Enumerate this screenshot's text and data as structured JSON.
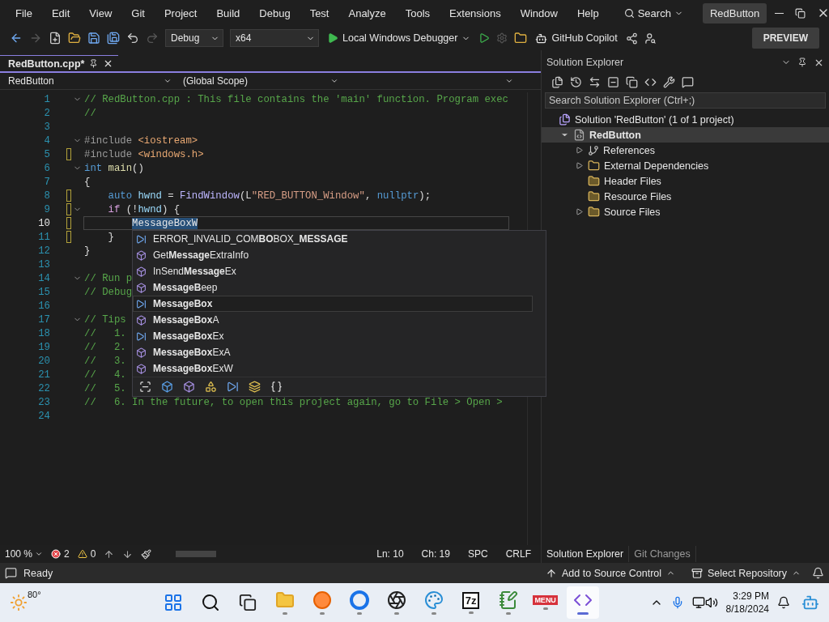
{
  "title_bar": {
    "menu": [
      "File",
      "Edit",
      "View",
      "Git",
      "Project",
      "Build",
      "Debug",
      "Test",
      "Analyze",
      "Tools",
      "Extensions",
      "Window",
      "Help"
    ],
    "search": "Search",
    "solution_name": "RedButton"
  },
  "toolbar": {
    "configuration": "Debug",
    "platform": "x64",
    "debugger": "Local Windows Debugger",
    "copilot": "GitHub Copilot",
    "preview": "PREVIEW"
  },
  "editor": {
    "tabs": [
      {
        "label": "RedButton.cpp*",
        "selected": true
      }
    ],
    "project": "RedButton",
    "scope": "(Global Scope)",
    "lines": [
      {
        "number": "1",
        "fold": true,
        "changed": false,
        "current": false,
        "tokens": [
          {
            "kind": "comment",
            "text": "// RedButton.cpp : This file contains the 'main' function. Program exec"
          }
        ]
      },
      {
        "number": "2",
        "fold": false,
        "changed": false,
        "current": false,
        "tokens": [
          {
            "kind": "comment",
            "text": "//"
          }
        ]
      },
      {
        "number": "3",
        "fold": false,
        "changed": false,
        "current": false
      },
      {
        "number": "4",
        "fold": true,
        "changed": false,
        "current": false,
        "tokens": [
          {
            "kind": "directive",
            "text": "#include "
          },
          {
            "kind": "header",
            "text": "<iostream>"
          }
        ]
      },
      {
        "number": "5",
        "fold": false,
        "changed": true,
        "current": false,
        "tokens": [
          {
            "kind": "directive",
            "text": "#include "
          },
          {
            "kind": "header",
            "text": "<windows.h>"
          }
        ]
      },
      {
        "number": "6",
        "fold": true,
        "changed": false,
        "current": false,
        "tokens": [
          {
            "kind": "keyword",
            "text": "int "
          },
          {
            "kind": "function",
            "text": "main"
          },
          {
            "kind": "plain",
            "text": "()"
          }
        ]
      },
      {
        "number": "7",
        "fold": false,
        "changed": false,
        "current": false,
        "tokens": [
          {
            "kind": "plain",
            "text": "{"
          }
        ]
      },
      {
        "number": "8",
        "fold": false,
        "changed": true,
        "current": false,
        "tokens": [
          {
            "kind": "keyword",
            "text": "    auto "
          },
          {
            "kind": "variable",
            "text": "hwnd"
          },
          {
            "kind": "plain",
            "text": " = "
          },
          {
            "kind": "macro",
            "text": "FindWindow"
          },
          {
            "kind": "plain",
            "text": "(L"
          },
          {
            "kind": "string",
            "text": "\"RED_BUTTON_Window\""
          },
          {
            "kind": "plain",
            "text": ", "
          },
          {
            "kind": "keyword",
            "text": "nullptr"
          },
          {
            "kind": "plain",
            "text": ");"
          }
        ]
      },
      {
        "number": "9",
        "fold": true,
        "changed": true,
        "current": false,
        "tokens": [
          {
            "kind": "control",
            "text": "    if"
          },
          {
            "kind": "plain",
            "text": " (!"
          },
          {
            "kind": "variable",
            "text": "hwnd"
          },
          {
            "kind": "plain",
            "text": ") {"
          }
        ]
      },
      {
        "number": "10",
        "fold": false,
        "changed": true,
        "current": true,
        "tokens": [
          {
            "kind": "selection",
            "text": "        MessageBoxW"
          }
        ]
      },
      {
        "number": "11",
        "fold": false,
        "changed": true,
        "current": false,
        "tokens": [
          {
            "kind": "plain",
            "text": "    }"
          }
        ]
      },
      {
        "number": "12",
        "fold": false,
        "changed": false,
        "current": false,
        "tokens": [
          {
            "kind": "plain",
            "text": "}"
          }
        ]
      },
      {
        "number": "13",
        "fold": false,
        "changed": false,
        "current": false
      },
      {
        "number": "14",
        "fold": true,
        "changed": false,
        "current": false,
        "tokens": [
          {
            "kind": "comment",
            "text": "// Run p"
          }
        ]
      },
      {
        "number": "15",
        "fold": false,
        "changed": false,
        "current": false,
        "tokens": [
          {
            "kind": "comment",
            "text": "// Debug"
          }
        ]
      },
      {
        "number": "16",
        "fold": false,
        "changed": false,
        "current": false
      },
      {
        "number": "17",
        "fold": true,
        "changed": false,
        "current": false,
        "tokens": [
          {
            "kind": "comment",
            "text": "// Tips"
          }
        ]
      },
      {
        "number": "18",
        "fold": false,
        "changed": false,
        "current": false,
        "tokens": [
          {
            "kind": "comment",
            "text": "//   1."
          }
        ]
      },
      {
        "number": "19",
        "fold": false,
        "changed": false,
        "current": false,
        "tokens": [
          {
            "kind": "comment",
            "text": "//   2."
          }
        ]
      },
      {
        "number": "20",
        "fold": false,
        "changed": false,
        "current": false,
        "tokens": [
          {
            "kind": "comment",
            "text": "//   3."
          }
        ]
      },
      {
        "number": "21",
        "fold": false,
        "changed": false,
        "current": false,
        "tokens": [
          {
            "kind": "comment",
            "text": "//   4."
          }
        ]
      },
      {
        "number": "22",
        "fold": false,
        "changed": false,
        "current": false,
        "tokens": [
          {
            "kind": "comment",
            "text": "//   5."
          }
        ]
      },
      {
        "number": "23",
        "fold": false,
        "changed": false,
        "current": false,
        "tokens": [
          {
            "kind": "comment",
            "text": "//   6. In the future, to open this project again, go to File > Open >"
          }
        ]
      },
      {
        "number": "24",
        "fold": false,
        "changed": false,
        "current": false
      }
    ],
    "autocomplete": {
      "items": [
        {
          "kind": "macro",
          "label": "ERROR_INVALID_COM**BO**BOX_**MESSAGE**",
          "selected": false
        },
        {
          "kind": "function",
          "label": "Get**Message**ExtraInfo",
          "selected": false
        },
        {
          "kind": "function",
          "label": "InSend**Message**Ex",
          "selected": false
        },
        {
          "kind": "function",
          "label": "**MessageB**eep",
          "selected": false
        },
        {
          "kind": "macro",
          "label": "**MessageBox**",
          "selected": true
        },
        {
          "kind": "function",
          "label": "**MessageBox**A",
          "selected": false
        },
        {
          "kind": "macro",
          "label": "**MessageBox**Ex",
          "selected": false
        },
        {
          "kind": "function",
          "label": "**MessageBox**ExA",
          "selected": false
        },
        {
          "kind": "function",
          "label": "**MessageBox**ExW",
          "selected": false
        }
      ],
      "filters": [
        {
          "kind": "scan"
        },
        {
          "kind": "class"
        },
        {
          "kind": "function"
        },
        {
          "kind": "shapes"
        },
        {
          "kind": "macro"
        },
        {
          "kind": "stack"
        },
        {
          "kind": "braces"
        }
      ]
    },
    "status": {
      "zoom": "100 %",
      "errors": "2",
      "warnings": "0",
      "line": "Ln: 10",
      "column": "Ch: 19",
      "whitespace": "SPC",
      "line_endings": "CRLF"
    }
  },
  "solution_explorer": {
    "title": "Solution Explorer",
    "search": {
      "placeholder": "Search Solution Explorer (Ctrl+;)"
    },
    "tree": [
      {
        "kind": "solution",
        "label": "Solution 'RedButton' (1 of 1 project)",
        "selected": false,
        "children": [
          {
            "kind": "project",
            "label": "RedButton",
            "selected": true,
            "expanded": true,
            "children": [
              {
                "kind": "references",
                "label": "References",
                "selected": false,
                "expanded": false
              },
              {
                "kind": "dependencies",
                "label": "External Dependencies",
                "selected": false,
                "expanded": false
              },
              {
                "kind": "filter",
                "label": "Header Files",
                "selected": false
              },
              {
                "kind": "filter",
                "label": "Resource Files",
                "selected": false
              },
              {
                "kind": "filter",
                "label": "Source Files",
                "selected": false,
                "expanded": false
              }
            ]
          }
        ]
      }
    ],
    "tabs": [
      {
        "label": "Solution Explorer",
        "selected": true
      },
      {
        "label": "Git Changes",
        "selected": false
      }
    ]
  },
  "status_bar": {
    "state": "Ready",
    "source_control": "Add to Source Control",
    "repository": "Select Repository"
  },
  "taskbar": {
    "weather": "80°",
    "apps": [
      {
        "kind": "start",
        "running": false,
        "active": false
      },
      {
        "kind": "search",
        "running": false,
        "active": false
      },
      {
        "kind": "task-view",
        "running": false,
        "active": false
      },
      {
        "kind": "folder",
        "running": true,
        "active": false
      },
      {
        "kind": "fox",
        "running": true,
        "active": false
      },
      {
        "kind": "ring",
        "running": true,
        "active": false
      },
      {
        "kind": "aperture",
        "running": true,
        "active": false
      },
      {
        "kind": "palette",
        "running": true,
        "active": false
      },
      {
        "kind": "archiver",
        "label": "7z",
        "running": true,
        "active": false
      },
      {
        "kind": "notepad",
        "running": true,
        "active": false
      },
      {
        "kind": "menu-app",
        "label": "MENU",
        "running": true,
        "active": false
      },
      {
        "kind": "ide",
        "running": true,
        "active": true
      }
    ],
    "time": "3:29 PM",
    "date": "8/18/2024"
  }
}
